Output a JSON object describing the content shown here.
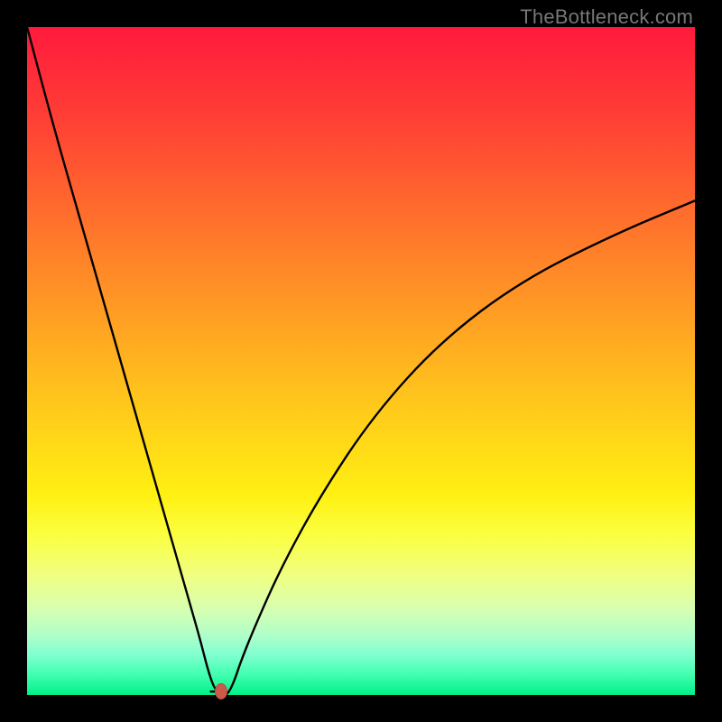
{
  "watermark": "TheBottleneck.com",
  "colors": {
    "frame": "#000000",
    "curve": "#000000",
    "marker": "#cc5a4a"
  },
  "chart_data": {
    "type": "line",
    "title": "",
    "xlabel": "",
    "ylabel": "",
    "xlim": [
      0,
      100
    ],
    "ylim": [
      0,
      100
    ],
    "grid": false,
    "legend": false,
    "series": [
      {
        "name": "bottleneck-curve",
        "x": [
          0,
          4,
          8,
          12,
          16,
          20,
          22,
          24,
          26,
          27,
          28,
          29,
          30,
          31,
          32,
          34,
          38,
          44,
          52,
          62,
          74,
          88,
          100
        ],
        "y": [
          100,
          85,
          71,
          57,
          43,
          29,
          22,
          15,
          8,
          4,
          1,
          0,
          0,
          2,
          5,
          10,
          19,
          30,
          42,
          53,
          62,
          69,
          74
        ]
      }
    ],
    "markers": [
      {
        "name": "optimal-point",
        "x": 29,
        "y": 0.5
      }
    ],
    "flat_segment": {
      "x_start": 27.5,
      "x_end": 29.5,
      "y": 0.5
    }
  }
}
